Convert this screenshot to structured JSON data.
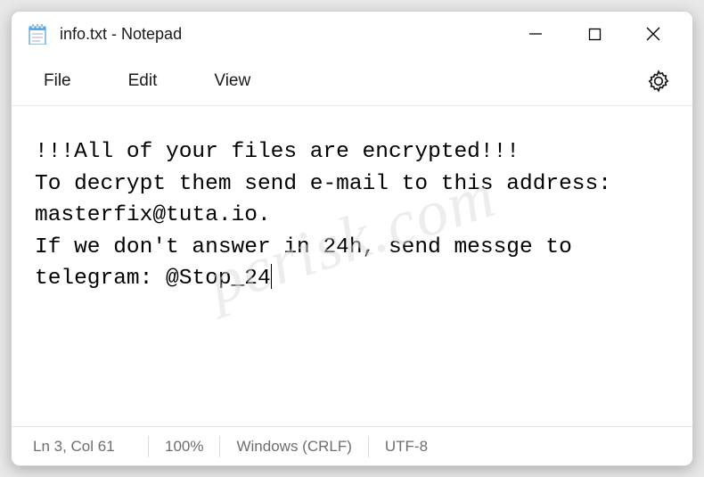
{
  "titlebar": {
    "title": "info.txt - Notepad"
  },
  "menubar": {
    "file": "File",
    "edit": "Edit",
    "view": "View"
  },
  "editor": {
    "line1": "!!!All of your files are encrypted!!!",
    "line2": "To decrypt them send e-mail to this address: masterfix@tuta.io.",
    "line3": "If we don't answer in 24h, send messge to telegram: @Stop_24"
  },
  "statusbar": {
    "position": "Ln 3, Col 61",
    "zoom": "100%",
    "line_ending": "Windows (CRLF)",
    "encoding": "UTF-8"
  },
  "watermark": "pcrisk.com"
}
